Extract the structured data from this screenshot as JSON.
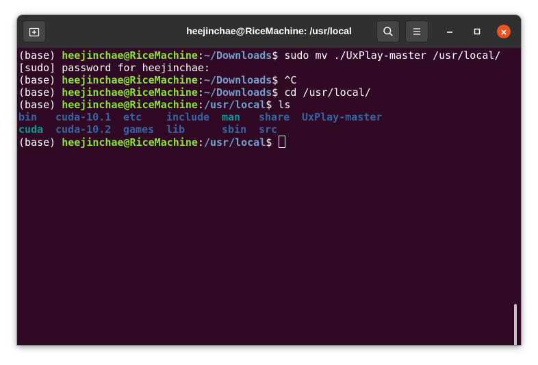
{
  "window": {
    "title": "heejinchae@RiceMachine: /usr/local"
  },
  "header": {
    "icons": {
      "new_tab": "new-tab-icon",
      "search": "search-icon",
      "menu": "hamburger-menu-icon",
      "minimize": "minimize-icon",
      "maximize": "maximize-icon",
      "close": "close-icon"
    }
  },
  "colors": {
    "terminal_bg": "#300a24",
    "titlebar_bg": "#303030",
    "prompt_user": "#8ae234",
    "prompt_path": "#729fcf",
    "dir_listing": "#3465a4",
    "link_listing": "#06989a",
    "close_button": "#e95420"
  },
  "terminal": {
    "env": "(base)",
    "user_host": "heejinchae@RiceMachine",
    "sep": ":",
    "lines": [
      {
        "path": "~/Downloads",
        "dollar": "$",
        "cmd": " sudo mv ./UxPlay-master /usr/local/"
      },
      {
        "text": "[sudo] password for heejinchae:"
      },
      {
        "path": "~/Downloads",
        "dollar": "$",
        "cmd": " ^C"
      },
      {
        "path": "~/Downloads",
        "dollar": "$",
        "cmd": " cd /usr/local/"
      },
      {
        "path": "/usr/local",
        "dollar": "$",
        "cmd": " ls"
      },
      {
        "path": "/usr/local",
        "dollar": "$",
        "cmd": " "
      }
    ],
    "ls_row1": [
      "bin",
      "cuda-10.1",
      "etc",
      "include",
      "man",
      "share",
      "UxPlay-master"
    ],
    "ls_row2": [
      "cuda",
      "cuda-10.2",
      "games",
      "lib",
      "sbin",
      "src"
    ]
  }
}
